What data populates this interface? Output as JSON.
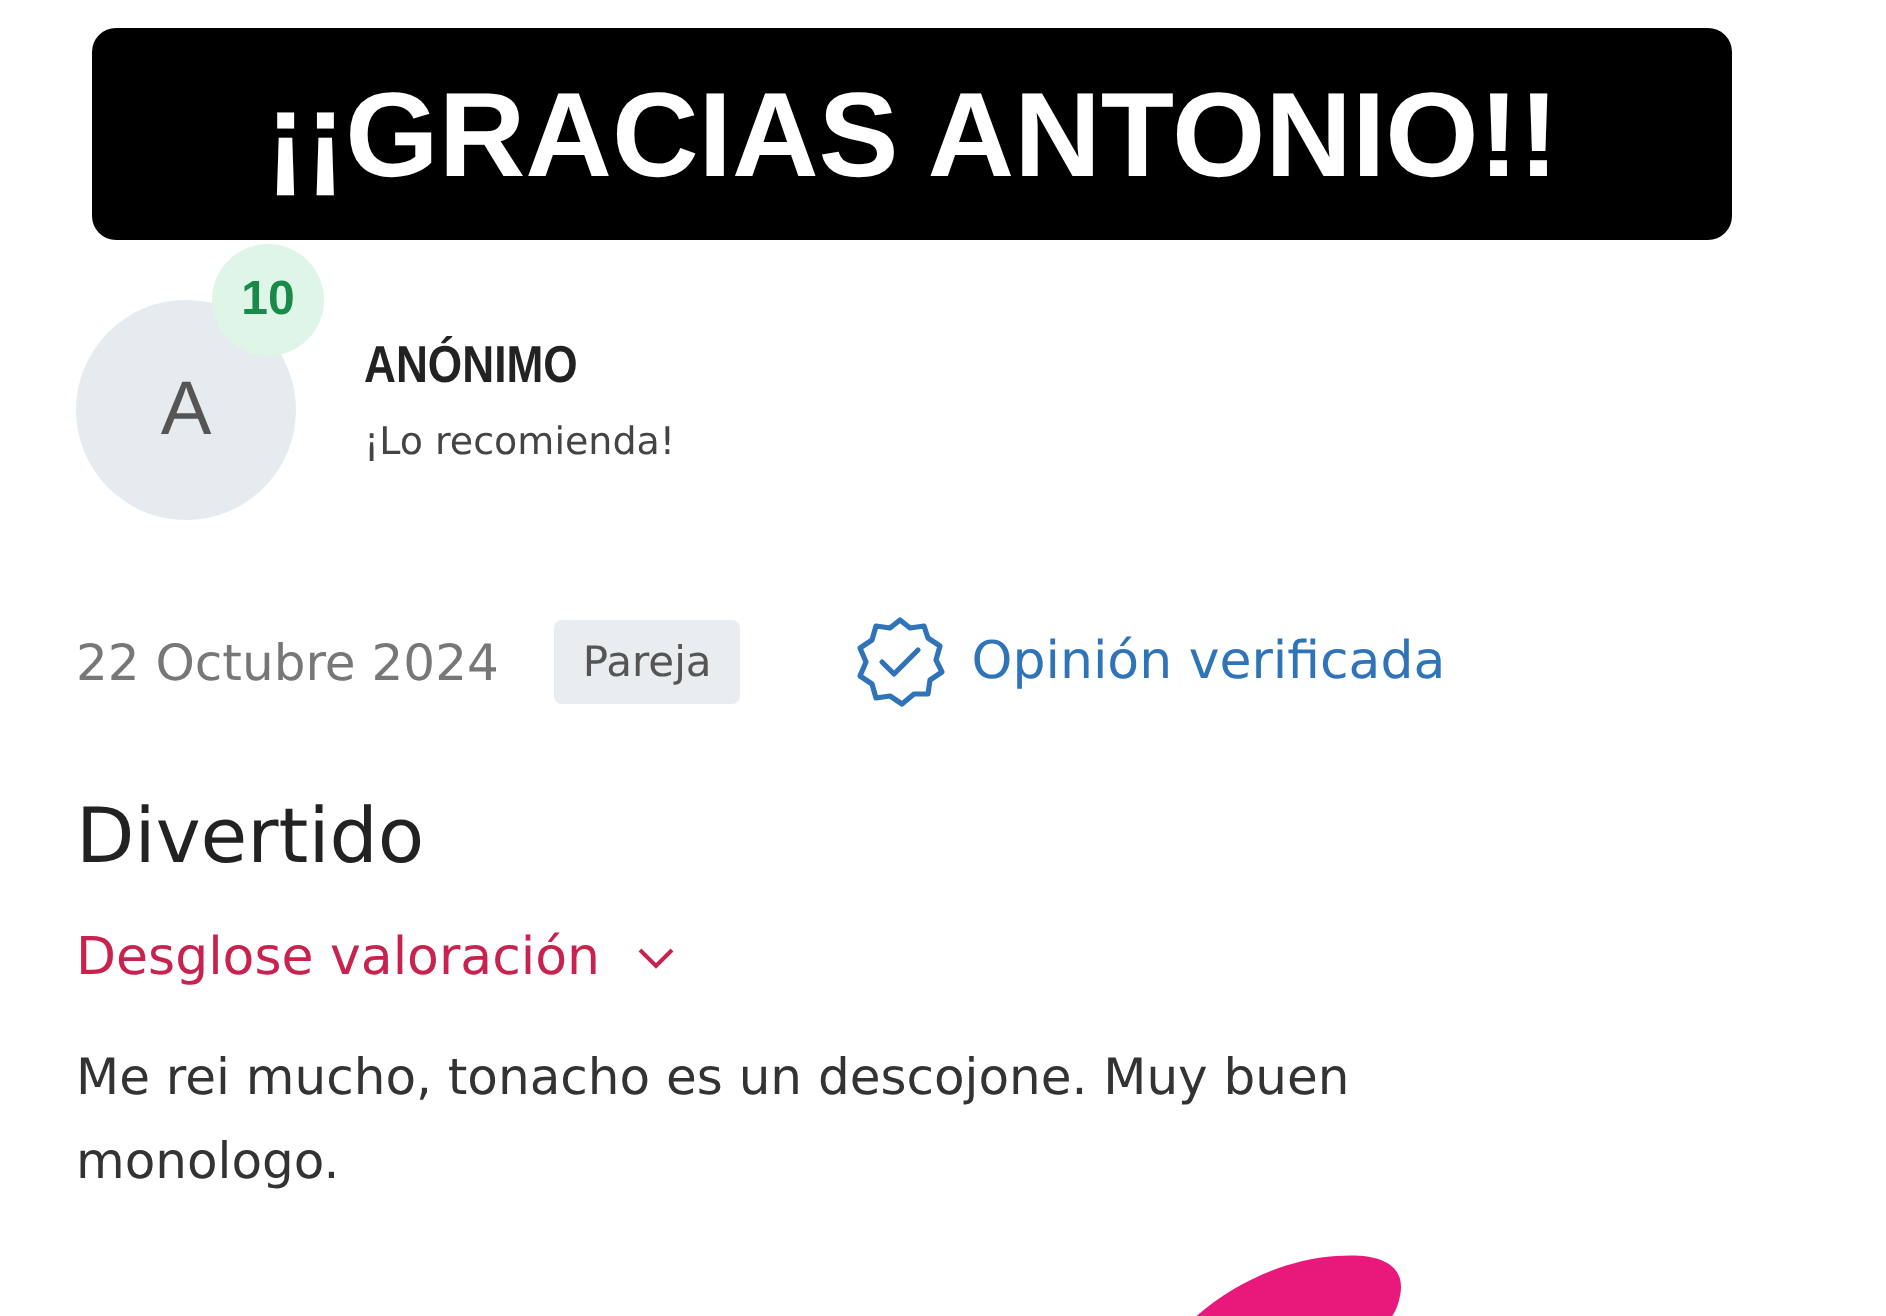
{
  "banner": {
    "title": "¡¡GRACIAS ANTONIO!!"
  },
  "review": {
    "avatar_initial": "A",
    "score": "10",
    "author": "ANÓNIMO",
    "recommendation": "¡Lo recomienda!",
    "date": "22 Octubre 2024",
    "tag": "Pareja",
    "verified": true,
    "verified_label": "Opinión verificada",
    "title": "Divertido",
    "breakdown": {
      "label": "Desglose valoración",
      "expanded": false
    },
    "text": "Me rei mucho, tonacho es un descojone. Muy buen monologo."
  }
}
